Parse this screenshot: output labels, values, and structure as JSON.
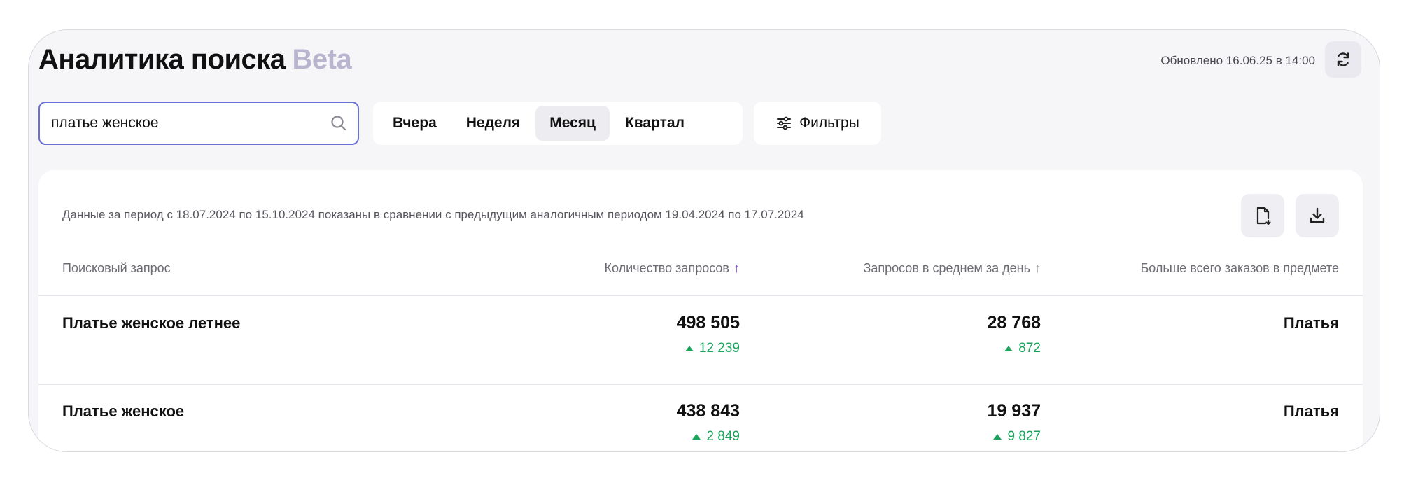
{
  "header": {
    "title": "Аналитика поиска",
    "badge": "Beta",
    "updated": "Обновлено 16.06.25 в 14:00",
    "refresh_icon": "refresh-icon"
  },
  "search": {
    "value": "платье женское",
    "icon": "search-icon"
  },
  "periods": [
    {
      "label": "Вчера",
      "active": false
    },
    {
      "label": "Неделя",
      "active": false
    },
    {
      "label": "Месяц",
      "active": true
    },
    {
      "label": "Квартал",
      "active": false
    }
  ],
  "filters": {
    "label": "Фильтры",
    "icon": "sliders-icon"
  },
  "card": {
    "period_note": "Данные за период с 18.07.2024 по 15.10.2024 показаны в сравнении с предыдущим аналогичным периодом 19.04.2024 по 17.07.2024",
    "actions": [
      {
        "name": "document-icon"
      },
      {
        "name": "download-icon"
      }
    ]
  },
  "table": {
    "columns": [
      "Поисковый запрос",
      "Количество запросов",
      "Запросов в среднем за день",
      "Больше всего заказов в предмете"
    ],
    "sort_arrow": "↑",
    "rows": [
      {
        "query": "Платье женское летнее",
        "count": "498 505",
        "count_delta": "12 239",
        "avg": "28 768",
        "avg_delta": "872",
        "subject": "Платья"
      },
      {
        "query": "Платье женское",
        "count": "438 843",
        "count_delta": "2 849",
        "avg": "19 937",
        "avg_delta": "9 827",
        "subject": "Платья"
      }
    ]
  },
  "colors": {
    "accent": "#6a6fd6",
    "sort_active": "#7b3fe4",
    "positive": "#1aa35a",
    "beta": "#b9b5cf"
  }
}
